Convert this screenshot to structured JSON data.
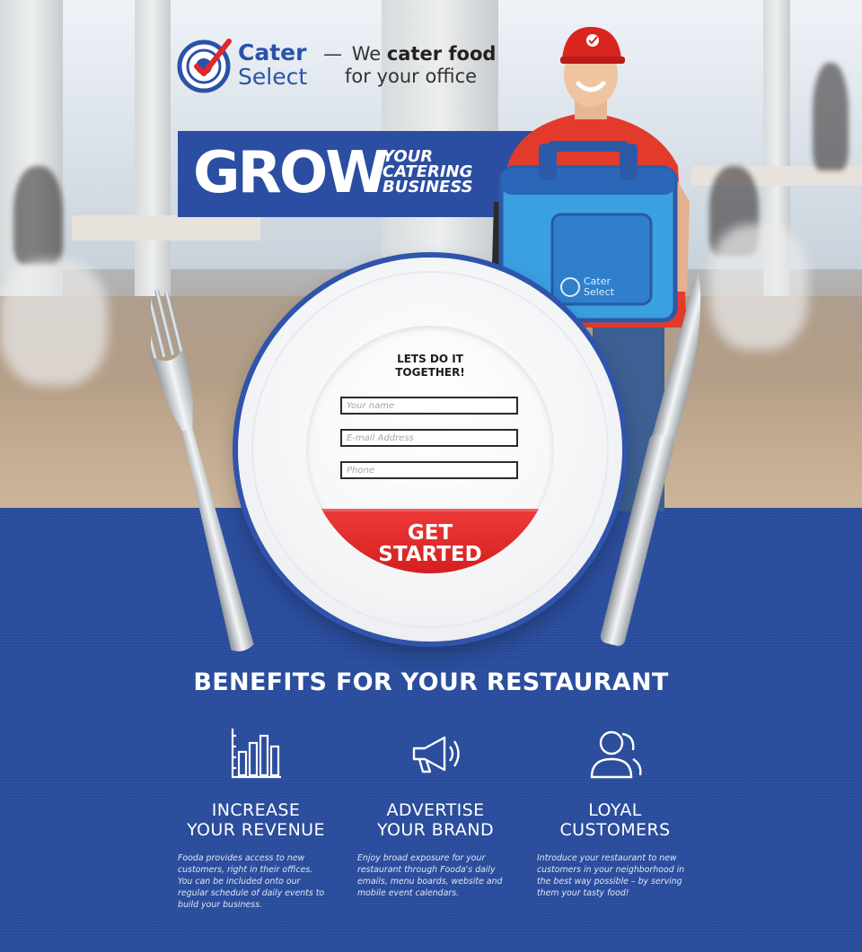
{
  "brand": {
    "name_line1": "Cater",
    "name_line2": "Select",
    "tagline_dash": "—",
    "tagline_pre": "We",
    "tagline_bold": "cater food",
    "tagline_line2": "for your office",
    "colors": {
      "primary": "#2b4ea3",
      "accent": "#e32626",
      "white": "#ffffff"
    }
  },
  "banner": {
    "headline": "GROW",
    "sub_line1": "YOUR",
    "sub_line2": "CATERING",
    "sub_line3": "BUSINESS"
  },
  "courier_bag_label": {
    "line1": "Cater",
    "line2": "Select"
  },
  "form": {
    "title_line1": "LETS DO IT",
    "title_line2": "TOGETHER!",
    "name_placeholder": "Your name",
    "email_placeholder": "E-mail Address",
    "phone_placeholder": "Phone",
    "submit_line1": "GET",
    "submit_line2": "STARTED"
  },
  "benefits": {
    "title": "BENEFITS FOR YOUR RESTAURANT",
    "items": [
      {
        "icon": "bar-chart-icon",
        "heading_line1": "INCREASE",
        "heading_line2": "YOUR REVENUE",
        "text": "Fooda provides access to new customers, right in their offices. You can be included onto our regular schedule of daily events to build your business."
      },
      {
        "icon": "megaphone-icon",
        "heading_line1": "ADVERTISE",
        "heading_line2": "YOUR BRAND",
        "text": "Enjoy broad exposure for your restaurant through Fooda's daily emails, menu boards, website and mobile event calendars."
      },
      {
        "icon": "users-icon",
        "heading_line1": "LOYAL",
        "heading_line2": "CUSTOMERS",
        "text": "Introduce your restaurant to new customers in your neighborhood in the best way possible – by serving them your tasty food!"
      }
    ]
  }
}
